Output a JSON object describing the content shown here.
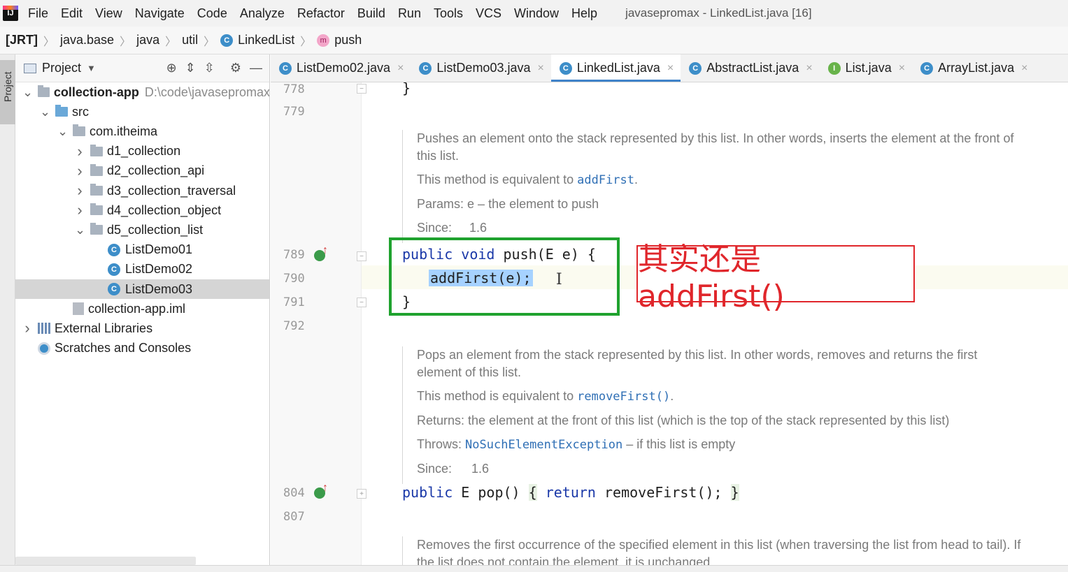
{
  "menubar": {
    "items": [
      "File",
      "Edit",
      "View",
      "Navigate",
      "Code",
      "Analyze",
      "Refactor",
      "Build",
      "Run",
      "Tools",
      "VCS",
      "Window",
      "Help"
    ],
    "window_title": "javasepromax - LinkedList.java [16]"
  },
  "breadcrumb": {
    "items": [
      "[JRT]",
      "java.base",
      "java",
      "util",
      "LinkedList",
      "push"
    ]
  },
  "toolstrip": {
    "label": "Project"
  },
  "project_panel": {
    "title": "Project",
    "tree": [
      {
        "label": "collection-app",
        "path": "D:\\code\\javasepromax",
        "indent": 0,
        "arrow": "v",
        "icon": "module-folder"
      },
      {
        "label": "src",
        "indent": 1,
        "arrow": "v",
        "icon": "source-folder"
      },
      {
        "label": "com.itheima",
        "indent": 2,
        "arrow": "v",
        "icon": "package-folder"
      },
      {
        "label": "d1_collection",
        "indent": 3,
        "arrow": ">",
        "icon": "package-folder"
      },
      {
        "label": "d2_collection_api",
        "indent": 3,
        "arrow": ">",
        "icon": "package-folder"
      },
      {
        "label": "d3_collection_traversal",
        "indent": 3,
        "arrow": ">",
        "icon": "package-folder"
      },
      {
        "label": "d4_collection_object",
        "indent": 3,
        "arrow": ">",
        "icon": "package-folder"
      },
      {
        "label": "d5_collection_list",
        "indent": 3,
        "arrow": "v",
        "icon": "package-folder"
      },
      {
        "label": "ListDemo01",
        "indent": 4,
        "arrow": "",
        "icon": "class"
      },
      {
        "label": "ListDemo02",
        "indent": 4,
        "arrow": "",
        "icon": "class"
      },
      {
        "label": "ListDemo03",
        "indent": 4,
        "arrow": "",
        "icon": "class",
        "selected": true
      },
      {
        "label": "collection-app.iml",
        "indent": 2,
        "arrow": "",
        "icon": "iml"
      },
      {
        "label": "External Libraries",
        "indent": 0,
        "arrow": ">",
        "icon": "library"
      },
      {
        "label": "Scratches and Consoles",
        "indent": 0,
        "arrow": "",
        "icon": "scratch"
      }
    ]
  },
  "tabs": [
    {
      "label": "ListDemo02.java",
      "icon": "C",
      "active": false
    },
    {
      "label": "ListDemo03.java",
      "icon": "C",
      "active": false
    },
    {
      "label": "LinkedList.java",
      "icon": "C",
      "active": true
    },
    {
      "label": "AbstractList.java",
      "icon": "C",
      "active": false
    },
    {
      "label": "List.java",
      "icon": "I",
      "active": false
    },
    {
      "label": "ArrayList.java",
      "icon": "C",
      "active": false
    }
  ],
  "editor": {
    "line_numbers": {
      "l778": "778",
      "l779": "779",
      "l789": "789",
      "l790": "790",
      "l791": "791",
      "l792": "792",
      "l804": "804",
      "l807": "807"
    },
    "code": {
      "l778_text": "}",
      "push_kw": "public void",
      "push_rest": " push(E e) {",
      "body": "addFirst(e);",
      "close": "}",
      "pop_kw": "public",
      "pop_mid": " E pop() ",
      "pop_open": "{",
      "pop_return": " return",
      "pop_call": " removeFirst();",
      "pop_close": "}"
    },
    "doc_push": {
      "summary": "Pushes an element onto the stack represented by this list. In other words, inserts the element at the front of this list.",
      "equiv_prefix": "This method is equivalent to ",
      "equiv_link": "addFirst",
      "equiv_suffix": ".",
      "params_tag": "Params:",
      "params_value": "e – the element to push",
      "since_tag": "Since:",
      "since_value": "1.6"
    },
    "doc_pop": {
      "summary": "Pops an element from the stack represented by this list. In other words, removes and returns the first element of this list.",
      "equiv_prefix": "This method is equivalent to ",
      "equiv_link": "removeFirst()",
      "equiv_suffix": ".",
      "returns_tag": "Returns:",
      "returns_value": "the element at the front of this list (which is the top of the stack represented by this list)",
      "throws_tag": "Throws:",
      "throws_link": "NoSuchElementException",
      "throws_value": " – if this list is empty",
      "since_tag": "Since:",
      "since_value": "1.6"
    },
    "doc_remove": {
      "summary": "Removes the first occurrence of the specified element in this list (when traversing the list from head to tail). If the list does not contain the element, it is unchanged."
    }
  },
  "annotation": {
    "text": "其实还是 addFirst()",
    "color": "#e0262b"
  },
  "colors": {
    "highlight_box": "#1fa22e",
    "keyword": "#1a38a8",
    "selection": "#a6d2ff",
    "tab_underline": "#4083c9"
  }
}
